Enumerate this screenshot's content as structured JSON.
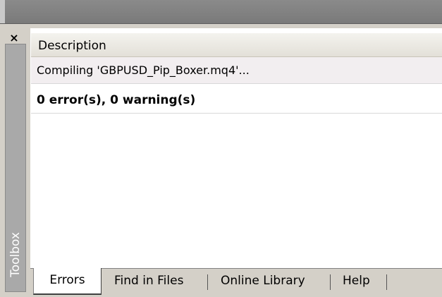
{
  "toolbox": {
    "label": "Toolbox",
    "close_glyph": "×"
  },
  "table": {
    "header": "Description",
    "rows": [
      "Compiling 'GBPUSD_Pip_Boxer.mq4'...",
      "0 error(s), 0 warning(s)"
    ]
  },
  "tabs": [
    {
      "label": "Errors"
    },
    {
      "label": "Find in Files"
    },
    {
      "label": "Online Library"
    },
    {
      "label": "Help"
    }
  ]
}
